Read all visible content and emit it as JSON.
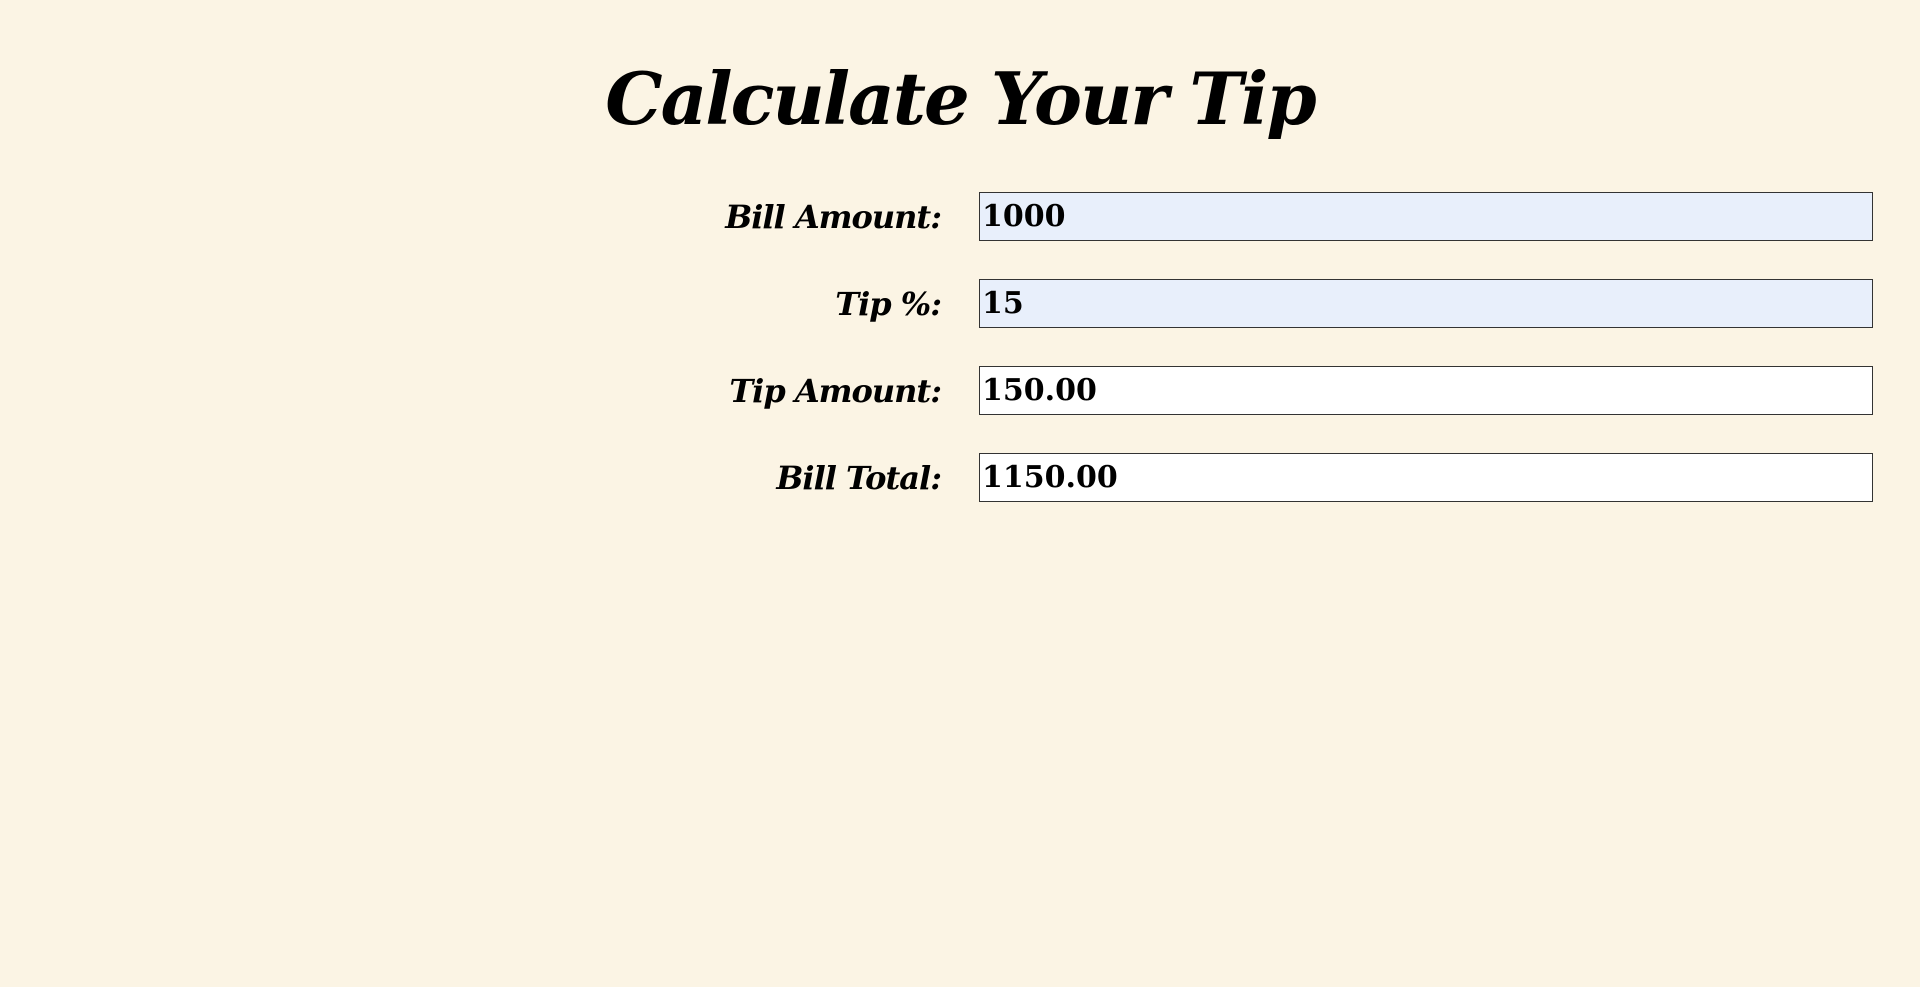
{
  "page": {
    "title": "Calculate Your Tip"
  },
  "form": {
    "fields": [
      {
        "label": "Bill Amount:",
        "value": "1000"
      },
      {
        "label": "Tip %:",
        "value": "15"
      },
      {
        "label": "Tip Amount:",
        "value": "150.00"
      },
      {
        "label": "Bill Total:",
        "value": "1150.00"
      }
    ]
  },
  "colors": {
    "background": "#fbf4e4",
    "editable_input_bg": "#e8effb",
    "readonly_input_bg": "#ffffff"
  }
}
